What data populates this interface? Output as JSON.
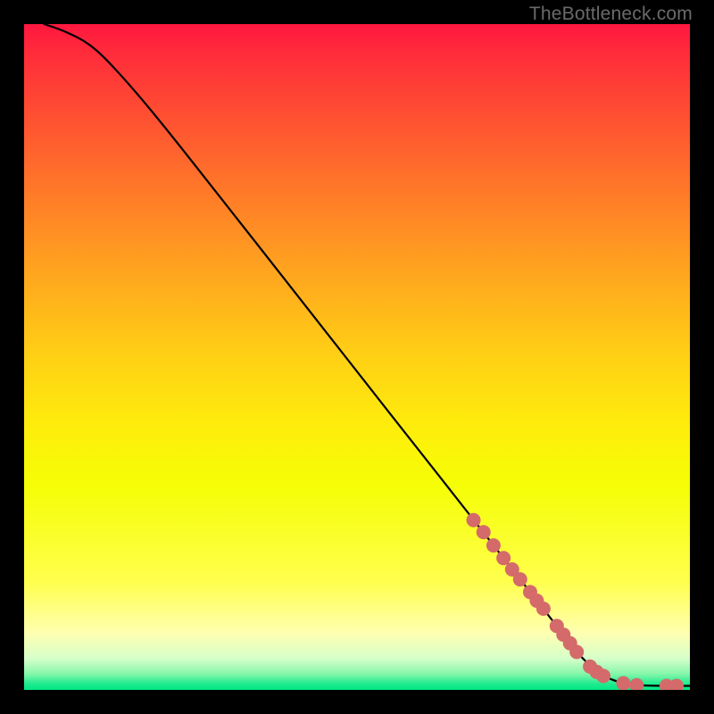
{
  "watermark": "TheBottleneck.com",
  "chart_data": {
    "type": "line",
    "title": "",
    "xlabel": "",
    "ylabel": "",
    "xlim": [
      0,
      100
    ],
    "ylim": [
      0,
      100
    ],
    "grid": false,
    "legend": false,
    "gradient_stops": [
      {
        "pct": 0.0,
        "color": "#ff173f"
      },
      {
        "pct": 4.4,
        "color": "#ff2c3a"
      },
      {
        "pct": 21.8,
        "color": "#ff6d2b"
      },
      {
        "pct": 36.7,
        "color": "#ffa31f"
      },
      {
        "pct": 49.6,
        "color": "#ffcf15"
      },
      {
        "pct": 60.4,
        "color": "#feed0c"
      },
      {
        "pct": 69.2,
        "color": "#f5fe05"
      },
      {
        "pct": 83.7,
        "color": "#ffff4d"
      },
      {
        "pct": 91.4,
        "color": "#ffffb0"
      },
      {
        "pct": 95.3,
        "color": "#d6ffc9"
      },
      {
        "pct": 97.5,
        "color": "#8af7ac"
      },
      {
        "pct": 99.1,
        "color": "#1feb8e"
      },
      {
        "pct": 100.0,
        "color": "#00e884"
      }
    ],
    "series": [
      {
        "name": "curve",
        "stroke": "#000000",
        "x": [
          3.0,
          6.0,
          10.0,
          14.0,
          20.0,
          30.0,
          40.0,
          50.0,
          60.0,
          67.0,
          72.0,
          76.0,
          80.0,
          83.0,
          86.0,
          88.0,
          90.0,
          92.0,
          95.0,
          100.0
        ],
        "y": [
          100.0,
          99.0,
          97.0,
          93.0,
          86.0,
          73.3,
          60.6,
          47.8,
          35.1,
          26.2,
          19.8,
          14.7,
          9.6,
          5.6,
          2.7,
          1.6,
          1.0,
          0.7,
          0.6,
          0.6
        ]
      }
    ],
    "markers": [
      {
        "x": 67.5,
        "y": 25.5
      },
      {
        "x": 69.0,
        "y": 23.7
      },
      {
        "x": 70.5,
        "y": 21.7
      },
      {
        "x": 72.0,
        "y": 19.8
      },
      {
        "x": 73.3,
        "y": 18.1
      },
      {
        "x": 74.5,
        "y": 16.6
      },
      {
        "x": 76.0,
        "y": 14.7
      },
      {
        "x": 77.0,
        "y": 13.4
      },
      {
        "x": 78.0,
        "y": 12.2
      },
      {
        "x": 80.0,
        "y": 9.6
      },
      {
        "x": 81.0,
        "y": 8.3
      },
      {
        "x": 82.0,
        "y": 7.0
      },
      {
        "x": 83.0,
        "y": 5.7
      },
      {
        "x": 85.0,
        "y": 3.5
      },
      {
        "x": 86.0,
        "y": 2.7
      },
      {
        "x": 87.0,
        "y": 2.1
      },
      {
        "x": 90.0,
        "y": 1.0
      },
      {
        "x": 92.0,
        "y": 0.7
      },
      {
        "x": 96.5,
        "y": 0.6
      },
      {
        "x": 98.0,
        "y": 0.6
      }
    ],
    "marker_style": {
      "color": "#d46a6a",
      "radius_px": 8
    }
  }
}
